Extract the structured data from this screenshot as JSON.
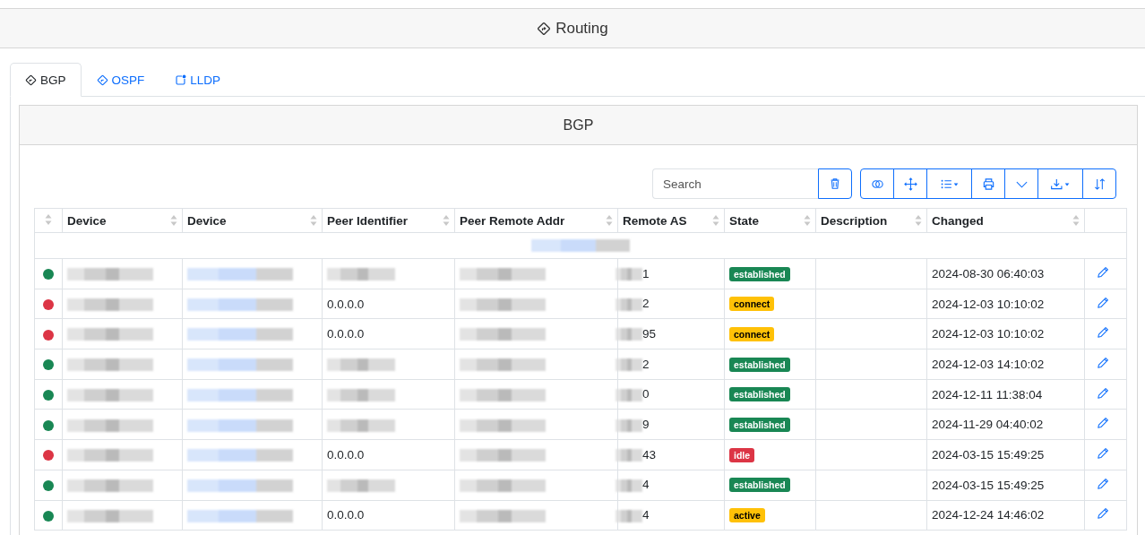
{
  "header": {
    "title": "Routing"
  },
  "tabs": [
    {
      "label": "BGP",
      "kind": "route",
      "selected": true
    },
    {
      "label": "OSPF",
      "kind": "route",
      "selected": false
    },
    {
      "label": "LLDP",
      "kind": "neighbor",
      "selected": false
    }
  ],
  "card": {
    "title": "BGP"
  },
  "search": {
    "placeholder": "Search"
  },
  "table": {
    "columns": [
      "Device",
      "Device",
      "Peer Identifier",
      "Peer Remote Addr",
      "Remote AS",
      "State",
      "Description",
      "Changed"
    ],
    "rows": [
      {
        "color": "#198754",
        "peer_identifier": "",
        "remote_as": "1",
        "state": "established",
        "kind": "success",
        "changed": "2024-08-30 06:40:03"
      },
      {
        "color": "#dc3545",
        "peer_identifier": "0.0.0.0",
        "remote_as": "2",
        "state": "connect",
        "kind": "warning",
        "changed": "2024-12-03 10:10:02"
      },
      {
        "color": "#dc3545",
        "peer_identifier": "0.0.0.0",
        "remote_as": "95",
        "state": "connect",
        "kind": "warning",
        "changed": "2024-12-03 10:10:02"
      },
      {
        "color": "#198754",
        "peer_identifier": "",
        "remote_as": "2",
        "state": "established",
        "kind": "success",
        "changed": "2024-12-03 14:10:02"
      },
      {
        "color": "#198754",
        "peer_identifier": "",
        "remote_as": "0",
        "state": "established",
        "kind": "success",
        "changed": "2024-12-11 11:38:04"
      },
      {
        "color": "#198754",
        "peer_identifier": "",
        "remote_as": "9",
        "state": "established",
        "kind": "success",
        "changed": "2024-11-29 04:40:02"
      },
      {
        "color": "#dc3545",
        "peer_identifier": "0.0.0.0",
        "remote_as": "43",
        "state": "idle",
        "kind": "danger",
        "changed": "2024-03-15 15:49:25"
      },
      {
        "color": "#198754",
        "peer_identifier": "",
        "remote_as": "4",
        "state": "established",
        "kind": "success",
        "changed": "2024-03-15 15:49:25"
      },
      {
        "color": "#198754",
        "peer_identifier": "0.0.0.0",
        "remote_as": "4",
        "state": "active",
        "kind": "warning",
        "changed": "2024-12-24 14:46:02"
      }
    ]
  }
}
